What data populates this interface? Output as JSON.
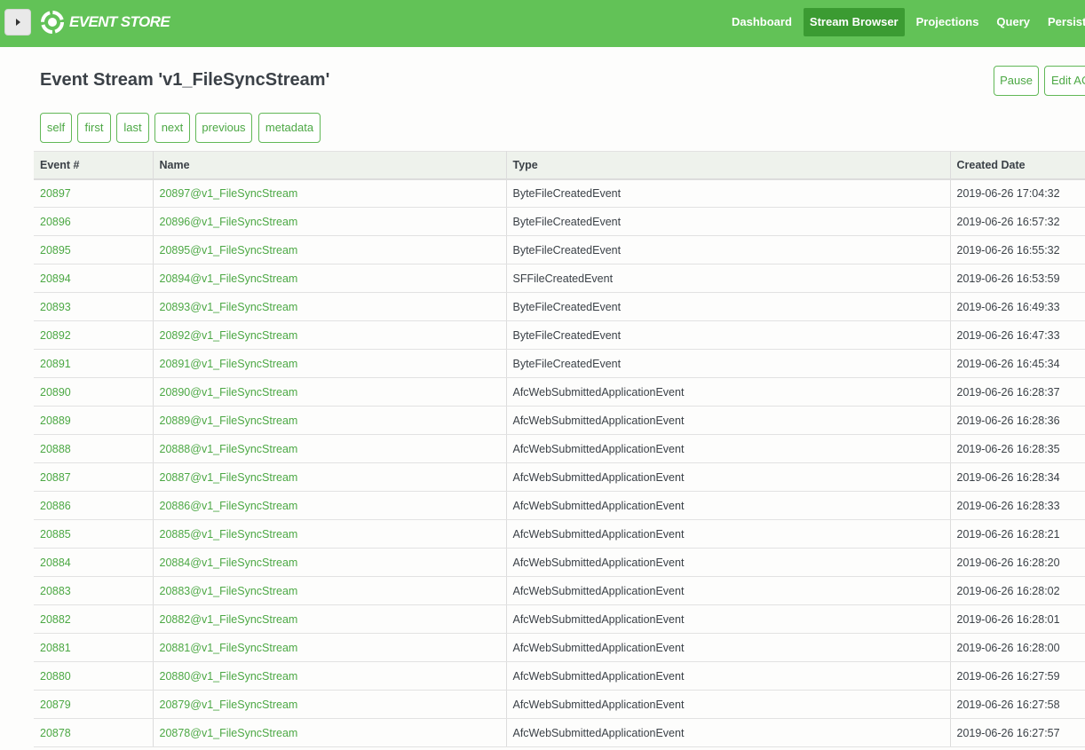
{
  "header": {
    "logo_text": "EVENT STORE",
    "nav": [
      {
        "label": "Dashboard",
        "active": false
      },
      {
        "label": "Stream Browser",
        "active": true
      },
      {
        "label": "Projections",
        "active": false
      },
      {
        "label": "Query",
        "active": false
      },
      {
        "label": "Persistent",
        "active": false
      }
    ]
  },
  "page": {
    "title": "Event Stream 'v1_FileSyncStream'",
    "actions": {
      "pause": "Pause",
      "edit_acl": "Edit AC"
    },
    "paging": [
      "self",
      "first",
      "last",
      "next",
      "previous",
      "metadata"
    ]
  },
  "table": {
    "columns": [
      "Event #",
      "Name",
      "Type",
      "Created Date"
    ],
    "rows": [
      [
        "20897",
        "20897@v1_FileSyncStream",
        "ByteFileCreatedEvent",
        "2019-06-26 17:04:32"
      ],
      [
        "20896",
        "20896@v1_FileSyncStream",
        "ByteFileCreatedEvent",
        "2019-06-26 16:57:32"
      ],
      [
        "20895",
        "20895@v1_FileSyncStream",
        "ByteFileCreatedEvent",
        "2019-06-26 16:55:32"
      ],
      [
        "20894",
        "20894@v1_FileSyncStream",
        "SFFileCreatedEvent",
        "2019-06-26 16:53:59"
      ],
      [
        "20893",
        "20893@v1_FileSyncStream",
        "ByteFileCreatedEvent",
        "2019-06-26 16:49:33"
      ],
      [
        "20892",
        "20892@v1_FileSyncStream",
        "ByteFileCreatedEvent",
        "2019-06-26 16:47:33"
      ],
      [
        "20891",
        "20891@v1_FileSyncStream",
        "ByteFileCreatedEvent",
        "2019-06-26 16:45:34"
      ],
      [
        "20890",
        "20890@v1_FileSyncStream",
        "AfcWebSubmittedApplicationEvent",
        "2019-06-26 16:28:37"
      ],
      [
        "20889",
        "20889@v1_FileSyncStream",
        "AfcWebSubmittedApplicationEvent",
        "2019-06-26 16:28:36"
      ],
      [
        "20888",
        "20888@v1_FileSyncStream",
        "AfcWebSubmittedApplicationEvent",
        "2019-06-26 16:28:35"
      ],
      [
        "20887",
        "20887@v1_FileSyncStream",
        "AfcWebSubmittedApplicationEvent",
        "2019-06-26 16:28:34"
      ],
      [
        "20886",
        "20886@v1_FileSyncStream",
        "AfcWebSubmittedApplicationEvent",
        "2019-06-26 16:28:33"
      ],
      [
        "20885",
        "20885@v1_FileSyncStream",
        "AfcWebSubmittedApplicationEvent",
        "2019-06-26 16:28:21"
      ],
      [
        "20884",
        "20884@v1_FileSyncStream",
        "AfcWebSubmittedApplicationEvent",
        "2019-06-26 16:28:20"
      ],
      [
        "20883",
        "20883@v1_FileSyncStream",
        "AfcWebSubmittedApplicationEvent",
        "2019-06-26 16:28:02"
      ],
      [
        "20882",
        "20882@v1_FileSyncStream",
        "AfcWebSubmittedApplicationEvent",
        "2019-06-26 16:28:01"
      ],
      [
        "20881",
        "20881@v1_FileSyncStream",
        "AfcWebSubmittedApplicationEvent",
        "2019-06-26 16:28:00"
      ],
      [
        "20880",
        "20880@v1_FileSyncStream",
        "AfcWebSubmittedApplicationEvent",
        "2019-06-26 16:27:59"
      ],
      [
        "20879",
        "20879@v1_FileSyncStream",
        "AfcWebSubmittedApplicationEvent",
        "2019-06-26 16:27:58"
      ],
      [
        "20878",
        "20878@v1_FileSyncStream",
        "AfcWebSubmittedApplicationEvent",
        "2019-06-26 16:27:57"
      ]
    ]
  },
  "icons": {
    "sidebar_toggle": "caret-right-icon",
    "logo": "event-store-logo-icon"
  },
  "colors": {
    "header_bg": "#62c257",
    "nav_active_bg": "#3b9b32",
    "link": "#4ca844",
    "text": "#3b4147"
  }
}
